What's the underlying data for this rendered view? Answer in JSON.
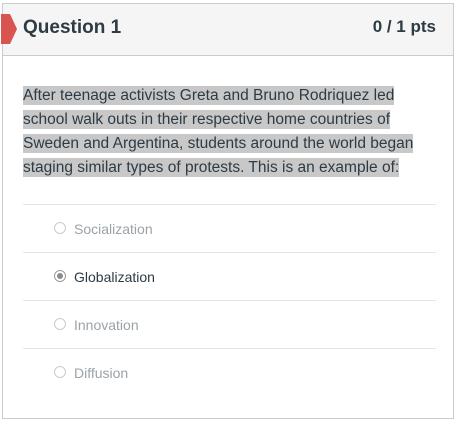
{
  "question": {
    "title": "Question 1",
    "points": "0 / 1 pts",
    "text": "After teenage activists Greta and Bruno Rodriquez led school walk outs in their respective home countries of Sweden and Argentina, students around the world began staging similar types of protests. This is an example of:",
    "marker_color": "#d9534f"
  },
  "answers": [
    {
      "label": "Socialization",
      "selected": false
    },
    {
      "label": "Globalization",
      "selected": true
    },
    {
      "label": "Innovation",
      "selected": false
    },
    {
      "label": "Diffusion",
      "selected": false
    }
  ]
}
